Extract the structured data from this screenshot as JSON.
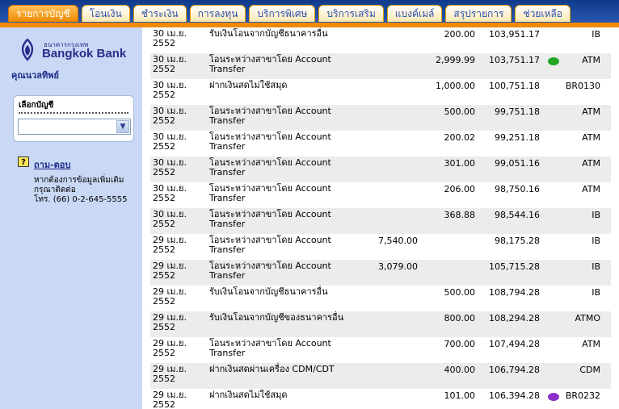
{
  "tabs": [
    {
      "label": "รายการบัญชี",
      "active": true
    },
    {
      "label": "โอนเงิน",
      "active": false
    },
    {
      "label": "ชำระเงิน",
      "active": false
    },
    {
      "label": "การลงทุน",
      "active": false
    },
    {
      "label": "บริการพิเศษ",
      "active": false
    },
    {
      "label": "บริการเสริม",
      "active": false
    },
    {
      "label": "แบงค์เมล์",
      "active": false
    },
    {
      "label": "สรุปรายการ",
      "active": false
    },
    {
      "label": "ช่วยเหลือ",
      "active": false
    }
  ],
  "sidebar": {
    "bank_name_thai": "ธนาคารกรุงเทพ",
    "bank_name": "Bangkok Bank",
    "username": "คุณนวลทิพย์",
    "account_title": "เลือกบัญชี",
    "account_selected": "",
    "help_link": "ถาม-ตอบ",
    "help_line1": "หากต้องการข้อมูลเพิ่มเติม",
    "help_line2": "กรุณาติดต่อ",
    "help_line3": "โทร. (66) 0-2-645-5555"
  },
  "colors": {
    "header_blue": "#0f3a8c",
    "tab_orange": "#f08a00",
    "sidebar_bg": "#c9d8f4",
    "row_shade": "#ececec",
    "mark_green": "#22a622",
    "mark_purple": "#8a2fc7"
  },
  "transactions": [
    {
      "date1": "30 เม.ย.",
      "date2": "2552",
      "desc1": "รับเงินโอนจากบัญชีธนาคารอื่น",
      "desc2": "",
      "withdraw": "",
      "deposit": "200.00",
      "balance": "103,951.17",
      "channel": "IB",
      "mark": ""
    },
    {
      "date1": "30 เม.ย.",
      "date2": "2552",
      "desc1": "โอนระหว่างสาขาโดย Account",
      "desc2": "Transfer",
      "withdraw": "",
      "deposit": "2,999.99",
      "balance": "103,751.17",
      "channel": "ATM",
      "mark": "green"
    },
    {
      "date1": "30 เม.ย.",
      "date2": "2552",
      "desc1": "ฝากเงินสดไม่ใช้สมุด",
      "desc2": "",
      "withdraw": "",
      "deposit": "1,000.00",
      "balance": "100,751.18",
      "channel": "BR0130",
      "mark": ""
    },
    {
      "date1": "30 เม.ย.",
      "date2": "2552",
      "desc1": "โอนระหว่างสาขาโดย Account",
      "desc2": "Transfer",
      "withdraw": "",
      "deposit": "500.00",
      "balance": "99,751.18",
      "channel": "ATM",
      "mark": ""
    },
    {
      "date1": "30 เม.ย.",
      "date2": "2552",
      "desc1": "โอนระหว่างสาขาโดย Account",
      "desc2": "Transfer",
      "withdraw": "",
      "deposit": "200.02",
      "balance": "99,251.18",
      "channel": "ATM",
      "mark": ""
    },
    {
      "date1": "30 เม.ย.",
      "date2": "2552",
      "desc1": "โอนระหว่างสาขาโดย Account",
      "desc2": "Transfer",
      "withdraw": "",
      "deposit": "301.00",
      "balance": "99,051.16",
      "channel": "ATM",
      "mark": ""
    },
    {
      "date1": "30 เม.ย.",
      "date2": "2552",
      "desc1": "โอนระหว่างสาขาโดย Account",
      "desc2": "Transfer",
      "withdraw": "",
      "deposit": "206.00",
      "balance": "98,750.16",
      "channel": "ATM",
      "mark": ""
    },
    {
      "date1": "30 เม.ย.",
      "date2": "2552",
      "desc1": "โอนระหว่างสาขาโดย Account",
      "desc2": "Transfer",
      "withdraw": "",
      "deposit": "368.88",
      "balance": "98,544.16",
      "channel": "IB",
      "mark": ""
    },
    {
      "date1": "29 เม.ย.",
      "date2": "2552",
      "desc1": "โอนระหว่างสาขาโดย Account",
      "desc2": "Transfer",
      "withdraw": "7,540.00",
      "deposit": "",
      "balance": "98,175.28",
      "channel": "IB",
      "mark": ""
    },
    {
      "date1": "29 เม.ย.",
      "date2": "2552",
      "desc1": "โอนระหว่างสาขาโดย Account",
      "desc2": "Transfer",
      "withdraw": "3,079.00",
      "deposit": "",
      "balance": "105,715.28",
      "channel": "IB",
      "mark": ""
    },
    {
      "date1": "29 เม.ย.",
      "date2": "2552",
      "desc1": "รับเงินโอนจากบัญชีธนาคารอื่น",
      "desc2": "",
      "withdraw": "",
      "deposit": "500.00",
      "balance": "108,794.28",
      "channel": "IB",
      "mark": ""
    },
    {
      "date1": "29 เม.ย.",
      "date2": "2552",
      "desc1": "รับเงินโอนจากบัญชีของธนาคารอื่น",
      "desc2": "",
      "withdraw": "",
      "deposit": "800.00",
      "balance": "108,294.28",
      "channel": "ATMO",
      "mark": ""
    },
    {
      "date1": "29 เม.ย.",
      "date2": "2552",
      "desc1": "โอนระหว่างสาขาโดย Account",
      "desc2": "Transfer",
      "withdraw": "",
      "deposit": "700.00",
      "balance": "107,494.28",
      "channel": "ATM",
      "mark": ""
    },
    {
      "date1": "29 เม.ย.",
      "date2": "2552",
      "desc1": "ฝากเงินสดผ่านเครื่อง CDM/CDT",
      "desc2": "",
      "withdraw": "",
      "deposit": "400.00",
      "balance": "106,794.28",
      "channel": "CDM",
      "mark": ""
    },
    {
      "date1": "29 เม.ย.",
      "date2": "2552",
      "desc1": "ฝากเงินสดไม่ใช้สมุด",
      "desc2": "",
      "withdraw": "",
      "deposit": "101.00",
      "balance": "106,394.28",
      "channel": "BR0232",
      "mark": "purple"
    }
  ]
}
